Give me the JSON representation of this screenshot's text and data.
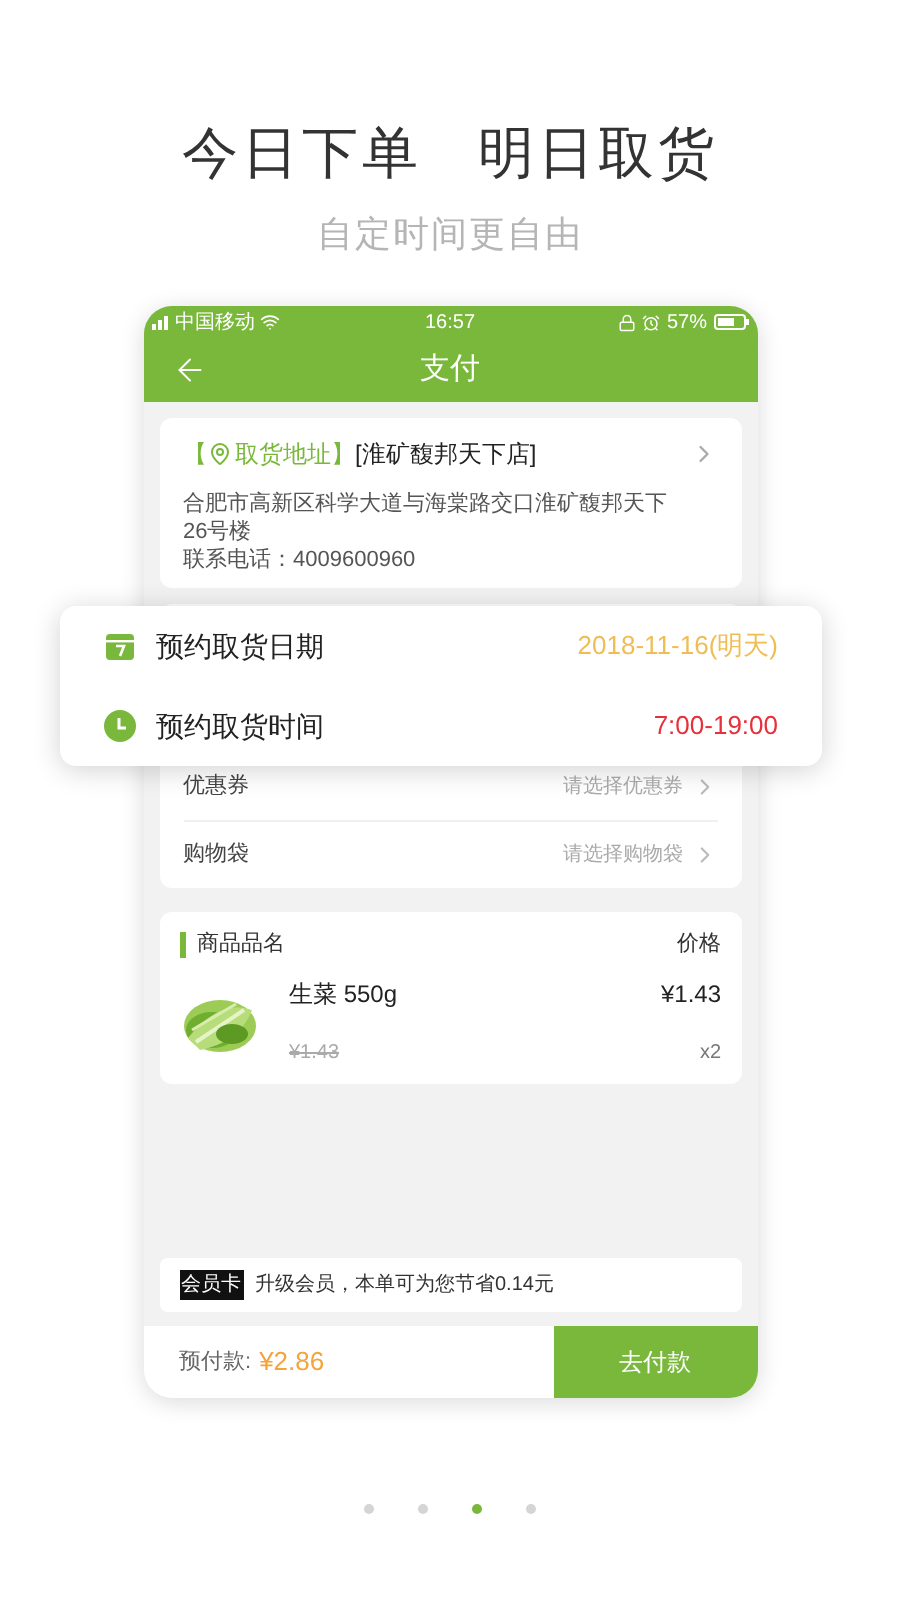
{
  "headline": {
    "parts": [
      "今日下单",
      "明日取货"
    ],
    "subtitle": "自定时间更自由"
  },
  "status_bar": {
    "carrier": "中国移动",
    "time": "16:57",
    "battery": "57%"
  },
  "header": {
    "title": "支付"
  },
  "pickup": {
    "tag_open": "【",
    "tag": "取货地址",
    "tag_close": "】",
    "store": "[淮矿馥邦天下店]",
    "address": "合肥市高新区科学大道与海棠路交口淮矿馥邦天下26号楼",
    "phone": "联系电话：4009600960"
  },
  "schedule": [
    {
      "kind": "date",
      "label": "预约取货日期",
      "value": "2018-11-16(明天)",
      "color": "#f0bd55"
    },
    {
      "kind": "time",
      "label": "预约取货时间",
      "value": "7:00-19:00",
      "color": "#e8303a"
    }
  ],
  "options": [
    {
      "label": "优惠券",
      "hint": "请选择优惠券"
    },
    {
      "label": "购物袋",
      "hint": "请选择购物袋"
    }
  ],
  "products": {
    "name_heading": "商品品名",
    "price_heading": "价格",
    "items": [
      {
        "name": "生菜 550g",
        "price": "¥1.43",
        "original_price": "¥1.43",
        "quantity": "x2"
      }
    ]
  },
  "member": {
    "badge": "会员卡",
    "text": "升级会员，本单可为您节省0.14元"
  },
  "footer": {
    "label": "预付款:",
    "amount": "¥2.86",
    "button": "去付款"
  },
  "pager": [
    {
      "selected": false
    },
    {
      "selected": false
    },
    {
      "selected": true
    },
    {
      "selected": false
    }
  ]
}
